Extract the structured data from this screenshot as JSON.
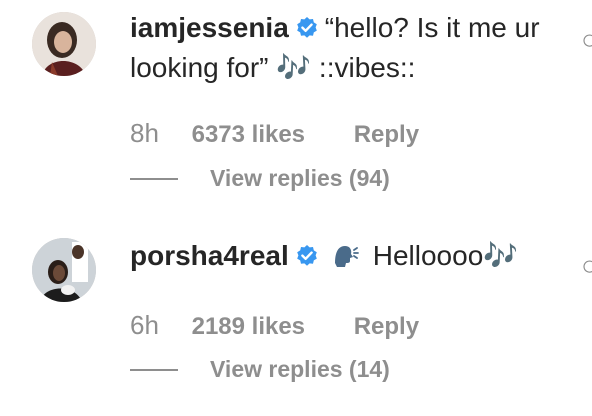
{
  "comments": [
    {
      "username": "iamjessenia",
      "text": "“hello? Is it me ur looking for” 🎶 ::vibes::",
      "time": "8h",
      "likes": "6373 likes",
      "reply_label": "Reply",
      "view_replies": "View replies (94)"
    },
    {
      "username": "porsha4real",
      "text_suffix": "Helloooo🎶",
      "time": "6h",
      "likes": "2189 likes",
      "reply_label": "Reply",
      "view_replies": "View replies (14)"
    }
  ],
  "icons": {
    "verified": "verified-badge-icon",
    "speaking_head": "speaking-head-icon",
    "edge": "heart-outline-icon"
  },
  "colors": {
    "verified_blue": "#3897f0",
    "muted": "#8e8e8e",
    "text": "#262626"
  }
}
